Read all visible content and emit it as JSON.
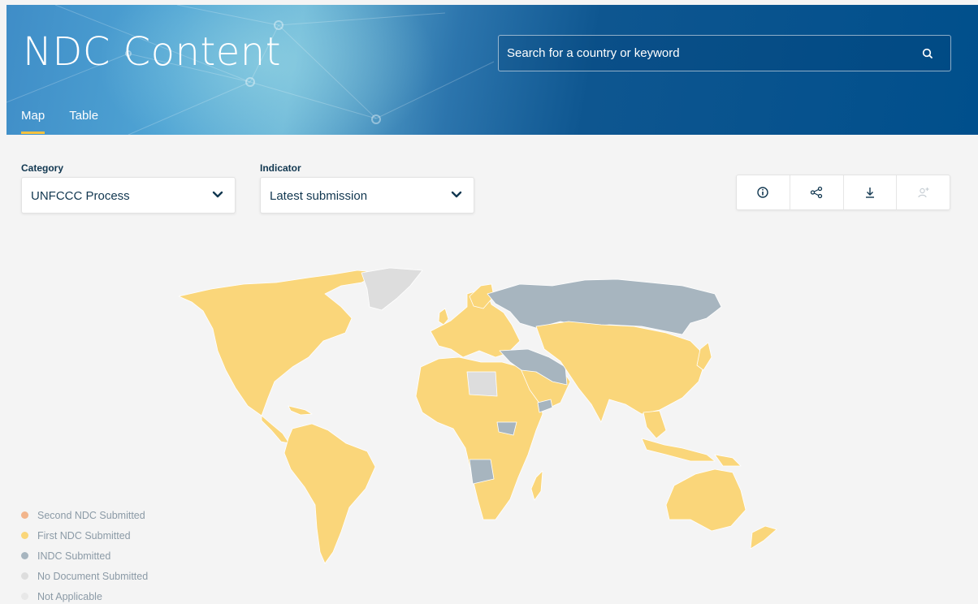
{
  "header": {
    "title": "NDC Content",
    "tabs": [
      {
        "label": "Map",
        "active": true
      },
      {
        "label": "Table",
        "active": false
      }
    ],
    "search": {
      "placeholder": "Search for a country or keyword",
      "value": ""
    }
  },
  "filters": {
    "category": {
      "label": "Category",
      "value": "UNFCCC Process"
    },
    "indicator": {
      "label": "Indicator",
      "value": "Latest submission"
    }
  },
  "toolbar": {
    "buttons": [
      {
        "icon": "info-icon",
        "active": true
      },
      {
        "icon": "share-icon",
        "active": true
      },
      {
        "icon": "download-icon",
        "active": true
      },
      {
        "icon": "add-user-icon",
        "active": false
      }
    ]
  },
  "legend": [
    {
      "label": "Second NDC Submitted",
      "color": "#f2b58c"
    },
    {
      "label": "First NDC Submitted",
      "color": "#fad67a"
    },
    {
      "label": "INDC Submitted",
      "color": "#a7b5bf"
    },
    {
      "label": "No Document Submitted",
      "color": "#dddddd"
    },
    {
      "label": "Not Applicable",
      "color": "#e8e8e8"
    }
  ],
  "colors": {
    "accent": "#f8c23f",
    "first_ndc": "#fad67a",
    "indc": "#a7b5bf",
    "no_document": "#dddddd",
    "text_dark": "#113750"
  }
}
